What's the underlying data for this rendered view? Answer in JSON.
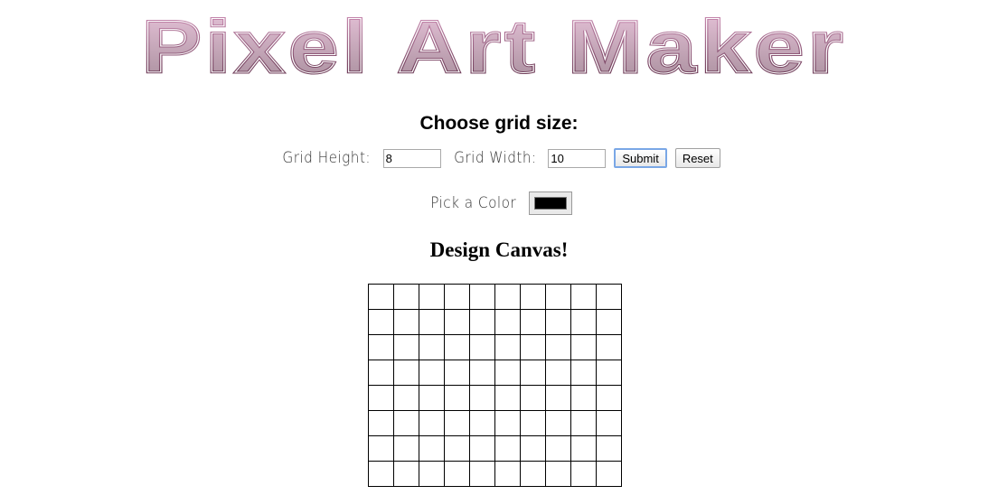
{
  "header": {
    "logo_text": "Pixel Art Maker",
    "logo_color": "#c77aa8"
  },
  "grid_size": {
    "title": "Choose grid size:",
    "height_label": "Grid Height:",
    "height_value": "8",
    "width_label": "Grid Width:",
    "width_value": "10",
    "submit_label": "Submit",
    "reset_label": "Reset"
  },
  "color_picker": {
    "label": "Pick a Color",
    "value": "#000000"
  },
  "canvas": {
    "title": "Design Canvas!",
    "rows": 8,
    "cols": 10
  }
}
